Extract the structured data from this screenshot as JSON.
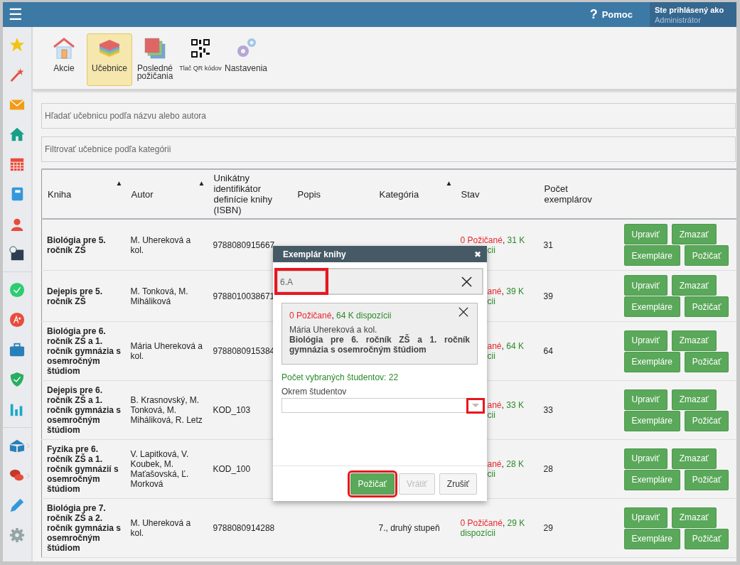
{
  "header": {
    "menu_icon": "☰",
    "help": {
      "icon": "?",
      "label": "Pomoc"
    },
    "user": {
      "caption": "Ste prihlásený ako",
      "name": "Administrátor"
    }
  },
  "sidebar": {
    "groups": [
      [
        {
          "kind": "star",
          "submenu": false
        },
        {
          "kind": "wand",
          "submenu": false
        },
        {
          "kind": "mail",
          "submenu": false
        },
        {
          "kind": "home",
          "submenu": false
        },
        {
          "kind": "calendar",
          "submenu": false
        },
        {
          "kind": "notebook",
          "submenu": false
        },
        {
          "kind": "person",
          "submenu": false
        },
        {
          "kind": "schedule",
          "submenu": false
        }
      ],
      [
        {
          "kind": "check",
          "submenu": false
        },
        {
          "kind": "grade",
          "submenu": false
        },
        {
          "kind": "briefcase",
          "submenu": false
        },
        {
          "kind": "shield",
          "submenu": false
        },
        {
          "kind": "chart",
          "submenu": false
        }
      ],
      [
        {
          "kind": "book",
          "submenu": true
        },
        {
          "kind": "chat",
          "submenu": true
        },
        {
          "kind": "pencil",
          "submenu": false
        },
        {
          "kind": "gear",
          "submenu": false
        }
      ]
    ]
  },
  "toolbar": [
    {
      "label": "Akcie",
      "kind": "house",
      "small": false,
      "selected": false
    },
    {
      "label": "Učebnice",
      "kind": "layers",
      "small": false,
      "selected": true
    },
    {
      "label": "Posledné požičania",
      "kind": "squares",
      "small": false,
      "selected": false
    },
    {
      "label": "Tlač QR kódov",
      "kind": "qr",
      "small": true,
      "selected": false
    },
    {
      "label": "Nastavenia",
      "kind": "gears",
      "small": false,
      "selected": false
    }
  ],
  "search": {
    "placeholder": "Hľadať učebnicu podľa názvu alebo autora"
  },
  "filter": {
    "placeholder": "Filtrovať učebnice podľa kategórii"
  },
  "table": {
    "columns": [
      {
        "label": "Kniha",
        "sort": "▲"
      },
      {
        "label": "Autor",
        "sort": "▲"
      },
      {
        "label": "Unikátny identifikátor definície knihy (ISBN)"
      },
      {
        "label": "Popis"
      },
      {
        "label": "Kategória",
        "sort": "▲"
      },
      {
        "label": "Stav"
      },
      {
        "label": "Počet exemplárov"
      },
      {}
    ],
    "rows": [
      {
        "book": "Biológia pre 5. ročník ZŠ",
        "author": "M. Uhereková a kol.",
        "isbn": "9788080915667",
        "category": "",
        "status": {
          "borrowed": "0 Požičané",
          "separator": ",",
          "available": "31 K",
          "rest": "cii",
          "first_clipped": false,
          "rest_clipped": true
        },
        "count": "31",
        "actions": [
          "Upraviť",
          "Zmazať",
          "Exempláre",
          "Požičať"
        ]
      },
      {
        "book": "Dejepis pre 5. ročník ZŠ",
        "author": "M. Tonková, M. Miháliková",
        "isbn": "9788010038671",
        "category": "",
        "status": {
          "borrowed": "ané",
          "separator": ",",
          "available": "39 K",
          "rest": "cii",
          "first_clipped": true,
          "rest_clipped": true
        },
        "count": "39",
        "actions": [
          "Upraviť",
          "Zmazať",
          "Exempláre",
          "Požičať"
        ]
      },
      {
        "book": "Biológia pre 6. ročník ZŠ a 1. ročník gymnázia s osemročným štúdiom",
        "author": "Mária Uhereková a kol.",
        "isbn": "9788080915384",
        "category": "",
        "status": {
          "borrowed": "ané",
          "separator": ",",
          "available": "64 K",
          "rest": "cii",
          "first_clipped": true,
          "rest_clipped": true
        },
        "count": "64",
        "actions": [
          "Upraviť",
          "Zmazať",
          "Exempláre",
          "Požičať"
        ]
      },
      {
        "book": "Dejepis pre 6. ročník ZŠ a 1. ročník gymnázia s osemročným štúdiom",
        "author": "B. Krasnovský, M. Tonková, M. Miháliková, R. Letz",
        "isbn": "KOD_103",
        "category": "",
        "status": {
          "borrowed": "ané",
          "separator": ",",
          "available": "33 K",
          "rest": "cii",
          "first_clipped": true,
          "rest_clipped": true
        },
        "count": "33",
        "actions": [
          "Upraviť",
          "Zmazať",
          "Exempláre",
          "Požičať"
        ]
      },
      {
        "book": "Fyzika pre 6. ročník ZŠ a 1. ročník gymnázií s osemročným štúdiom",
        "author": "V. Lapitková, V. Koubek, M. Maťašovská, Ľ. Morková",
        "isbn": "KOD_100",
        "category": "",
        "status": {
          "borrowed": "ané",
          "separator": ",",
          "available": "28 K",
          "rest": "cii",
          "first_clipped": true,
          "rest_clipped": true
        },
        "count": "28",
        "actions": [
          "Upraviť",
          "Zmazať",
          "Exempláre",
          "Požičať"
        ]
      },
      {
        "book": "Biológia pre 7. ročník ZŠ a 2. ročník gymnázia s osemročným štúdiom",
        "author": "M. Uhereková a kol.",
        "isbn": "9788080914288",
        "category": "7., druhý stupeň",
        "status": {
          "borrowed": "0 Požičané",
          "separator": ",",
          "available": "29 K",
          "rest": "dispozícii",
          "first_clipped": false,
          "rest_clipped": false
        },
        "count": "29",
        "actions": [
          "Upraviť",
          "Zmazať",
          "Exempláre",
          "Požičať"
        ]
      }
    ]
  },
  "modal": {
    "title": "Exemplár knihy",
    "close": "✖",
    "class_field": {
      "tags": [
        {
          "label": "6.A",
          "highlighted": true
        }
      ]
    },
    "book_card": {
      "borrowed": "0 Požičané",
      "separator": ",",
      "available": "64 K dispozícii",
      "author": "Mária Uhereková a kol.",
      "title": "Biológia pre 6. ročník ZŠ a 1. ročník gymnázia s osemročným štúdiom"
    },
    "selected_count": "Počet vybraných študentov: 22",
    "exclude": {
      "label": "Okrem študentov",
      "toggle_highlighted": true
    },
    "buttons": [
      {
        "label": "Požičať",
        "kind": "primary",
        "disabled": false,
        "highlighted": true
      },
      {
        "label": "Vrátiť",
        "kind": "default",
        "disabled": true,
        "highlighted": false
      },
      {
        "label": "Zrušiť",
        "kind": "default",
        "disabled": false,
        "highlighted": false
      }
    ]
  }
}
